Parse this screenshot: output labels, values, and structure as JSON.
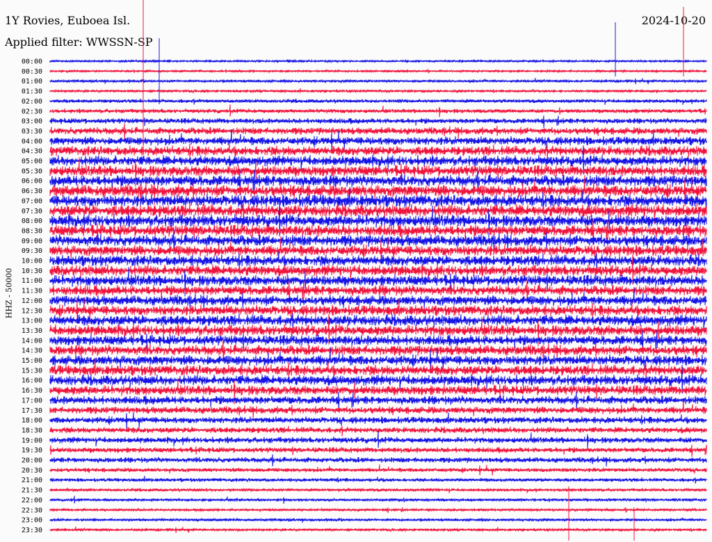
{
  "header": {
    "station": "1Y Rovies, Euboea Isl.",
    "date": "2024-10-20",
    "filter": "Applied filter: WWSSN-SP"
  },
  "chart_data": {
    "type": "line",
    "ylabel": "HHZ - 50000",
    "rows": [
      "00:00",
      "00:30",
      "01:00",
      "01:30",
      "02:00",
      "02:30",
      "03:00",
      "03:30",
      "04:00",
      "04:30",
      "05:00",
      "05:30",
      "06:00",
      "06:30",
      "07:00",
      "07:30",
      "08:00",
      "08:30",
      "09:00",
      "09:30",
      "10:00",
      "10:30",
      "11:00",
      "11:30",
      "12:00",
      "12:30",
      "13:00",
      "13:30",
      "14:00",
      "14:30",
      "15:00",
      "15:30",
      "16:00",
      "16:30",
      "17:00",
      "17:30",
      "18:00",
      "18:30",
      "19:00",
      "19:30",
      "20:00",
      "20:30",
      "21:00",
      "21:30",
      "22:00",
      "22:30",
      "23:00",
      "23:30"
    ],
    "series_colors": [
      "#1414e6",
      "#f0143c"
    ],
    "relative_amplitude": [
      0.15,
      0.15,
      0.2,
      0.2,
      0.3,
      0.35,
      0.45,
      0.6,
      0.7,
      0.8,
      0.85,
      0.9,
      0.95,
      1.0,
      1.0,
      1.0,
      1.0,
      0.95,
      0.95,
      0.9,
      0.9,
      0.9,
      0.9,
      0.85,
      0.85,
      0.85,
      0.9,
      0.9,
      0.85,
      0.85,
      0.85,
      0.85,
      0.85,
      0.8,
      0.7,
      0.6,
      0.55,
      0.5,
      0.5,
      0.45,
      0.45,
      0.35,
      0.3,
      0.25,
      0.22,
      0.2,
      0.2,
      0.2
    ]
  }
}
